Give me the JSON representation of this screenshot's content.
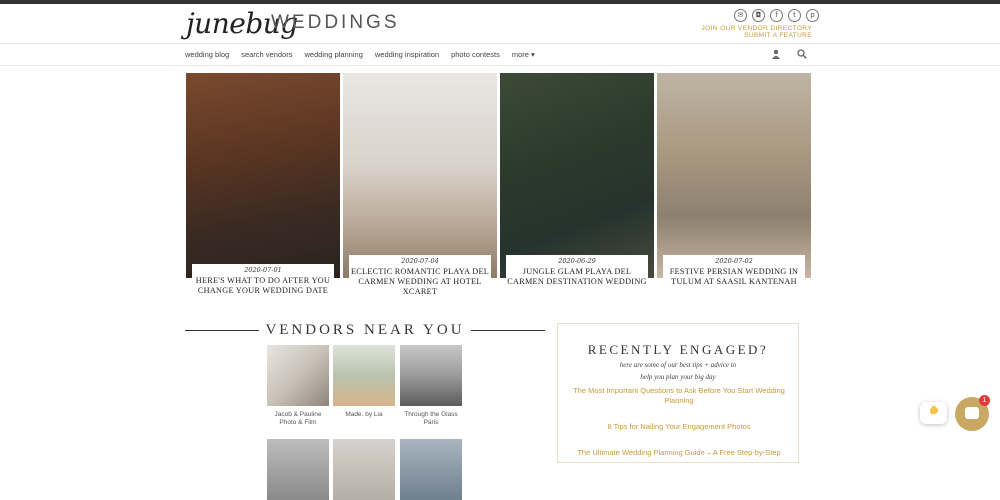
{
  "header": {
    "logo_script": "junebug",
    "logo_text": "WEDDINGS",
    "social_icons": [
      "email-icon",
      "instagram-icon",
      "facebook-icon",
      "twitter-icon",
      "pinterest-icon"
    ],
    "vendor_directory_label": "JOIN OUR VENDOR DIRECTORY",
    "submit_feature_label": "SUBMIT A FEATURE"
  },
  "nav": {
    "items": [
      "wedding blog",
      "search vendors",
      "wedding planning",
      "wedding inspiration",
      "photo contests",
      "more ▾"
    ],
    "icons": [
      "user-icon",
      "search-icon"
    ]
  },
  "featured": [
    {
      "date": "2020-07-01",
      "title": "Here's What to Do After You Change Your Wedding Date"
    },
    {
      "date": "2020-07-04",
      "title": "Eclectic Romantic Playa Del Carmen Wedding at Hotel Xcaret"
    },
    {
      "date": "2020-06-29",
      "title": "Jungle Glam Playa del Carmen Destination Wedding"
    },
    {
      "date": "2020-07-02",
      "title": "Festive Persian Wedding in Tulum at Saasil Kantenah"
    }
  ],
  "vendors": {
    "heading": "VENDORS NEAR YOU",
    "items": [
      {
        "name": "Jacob & Pauline Photo & Film"
      },
      {
        "name": "Made. by Lia"
      },
      {
        "name": "Through the Glass Paris"
      }
    ]
  },
  "engaged": {
    "heading": "RECENTLY ENGAGED?",
    "sub_line1": "here are some of our best tips + advice to",
    "sub_line2": "help you plan your big day",
    "links": [
      "The Most Important Questions to Ask Before You Start Wedding Planning",
      "8 Tips for Nailing Your Engagement Photos",
      "The Ultimate Wedding Planning Guide – A Free Step-by-Step"
    ]
  },
  "chat": {
    "bubble_icon": "waving-hand-icon",
    "badge_count": "1"
  },
  "colors": {
    "accent": "#c49a3a",
    "chat": "#c8a862",
    "badge": "#e03b3b"
  }
}
